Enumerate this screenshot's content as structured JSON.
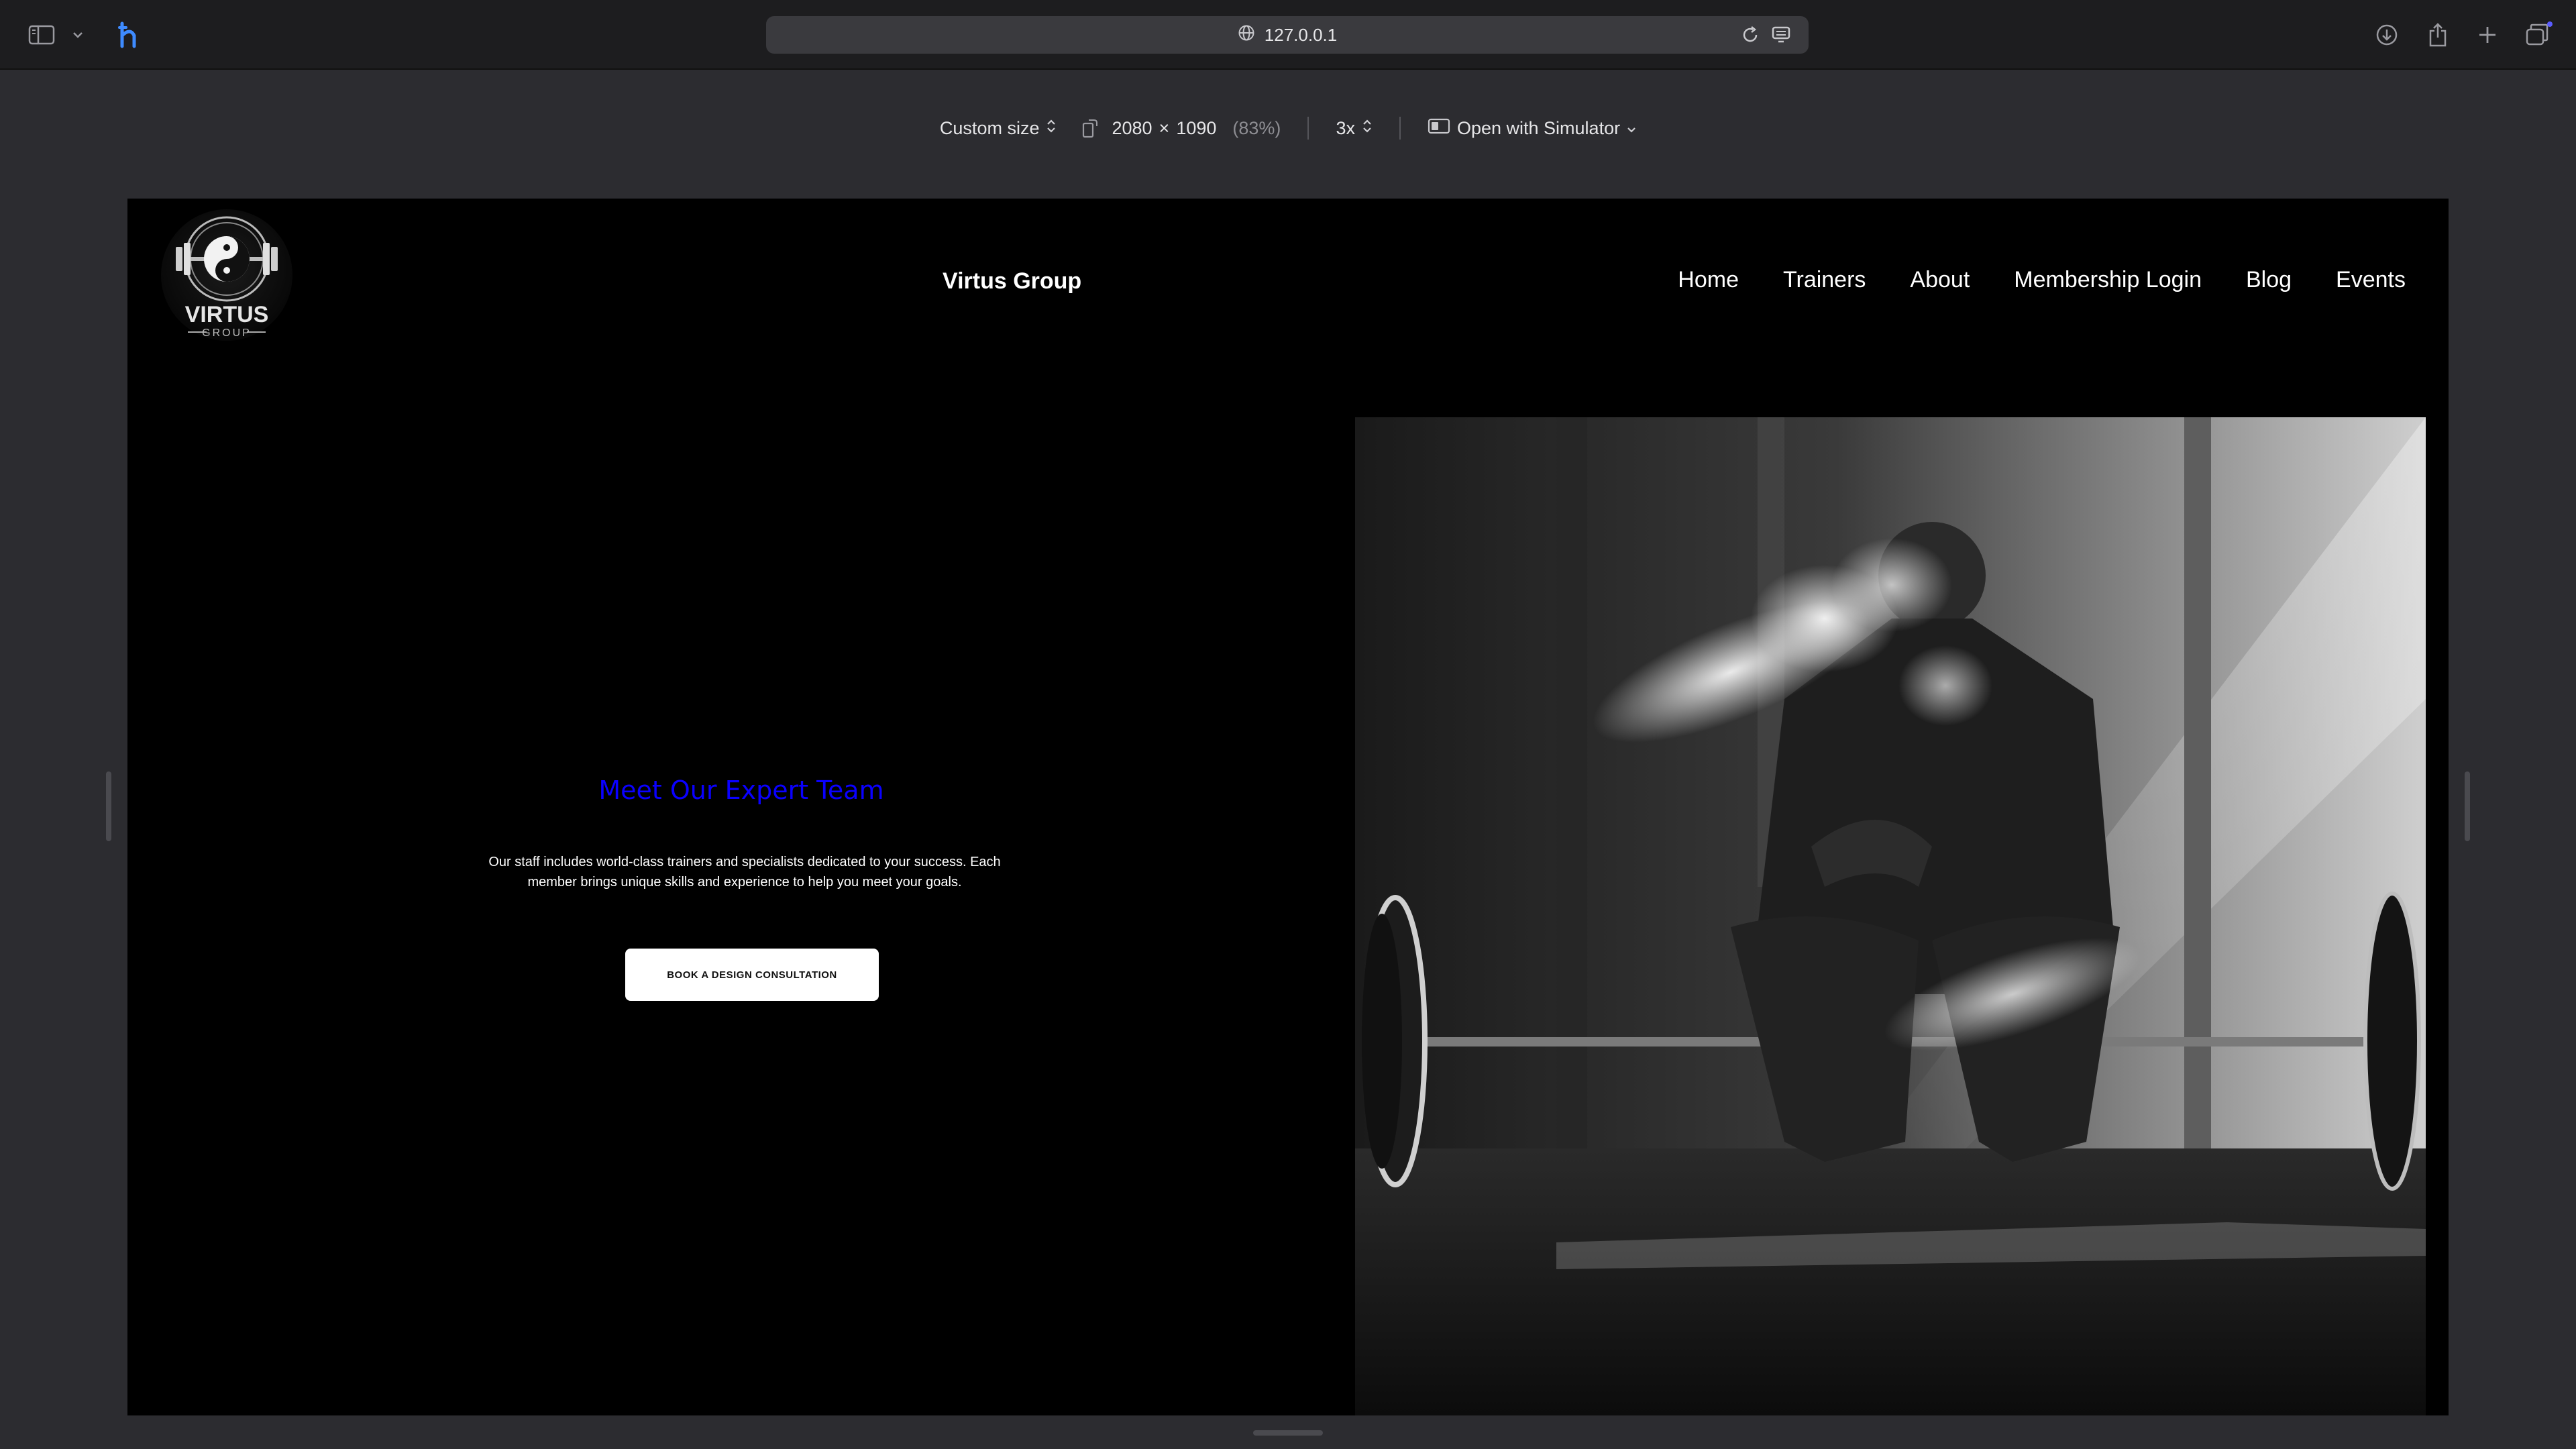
{
  "browser": {
    "url": "127.0.0.1"
  },
  "responsive_toolbar": {
    "size_mode": "Custom size",
    "width": "2080",
    "times": "×",
    "height": "1090",
    "zoom": "(83%)",
    "scale": "3x",
    "open_with": "Open with Simulator"
  },
  "site": {
    "title": "Virtus Group",
    "logo_text": "VIRTUS",
    "logo_subtext": "GROUP",
    "nav": [
      "Home",
      "Trainers",
      "About",
      "Membership Login",
      "Blog",
      "Events"
    ]
  },
  "hero": {
    "heading": "Meet Our Expert Team",
    "text": "Our staff includes world-class trainers and specialists dedicated to your success. Each member brings unique skills and experience to help you meet your goals.",
    "button": "BOOK A DESIGN CONSULTATION",
    "heading_color": "#0a00ff"
  },
  "colors": {
    "chrome_bg": "#1d1d1f",
    "canvas_bg": "#2c2c30",
    "site_bg": "#000000",
    "accent_blue": "#0a00ff"
  },
  "icons": [
    "sidebar-icon",
    "chevron-down-icon",
    "extension-icon",
    "globe-icon",
    "reload-icon",
    "reader-icon",
    "download-icon",
    "share-icon",
    "new-tab-icon",
    "tab-overview-icon",
    "rotate-icon",
    "device-icon"
  ]
}
